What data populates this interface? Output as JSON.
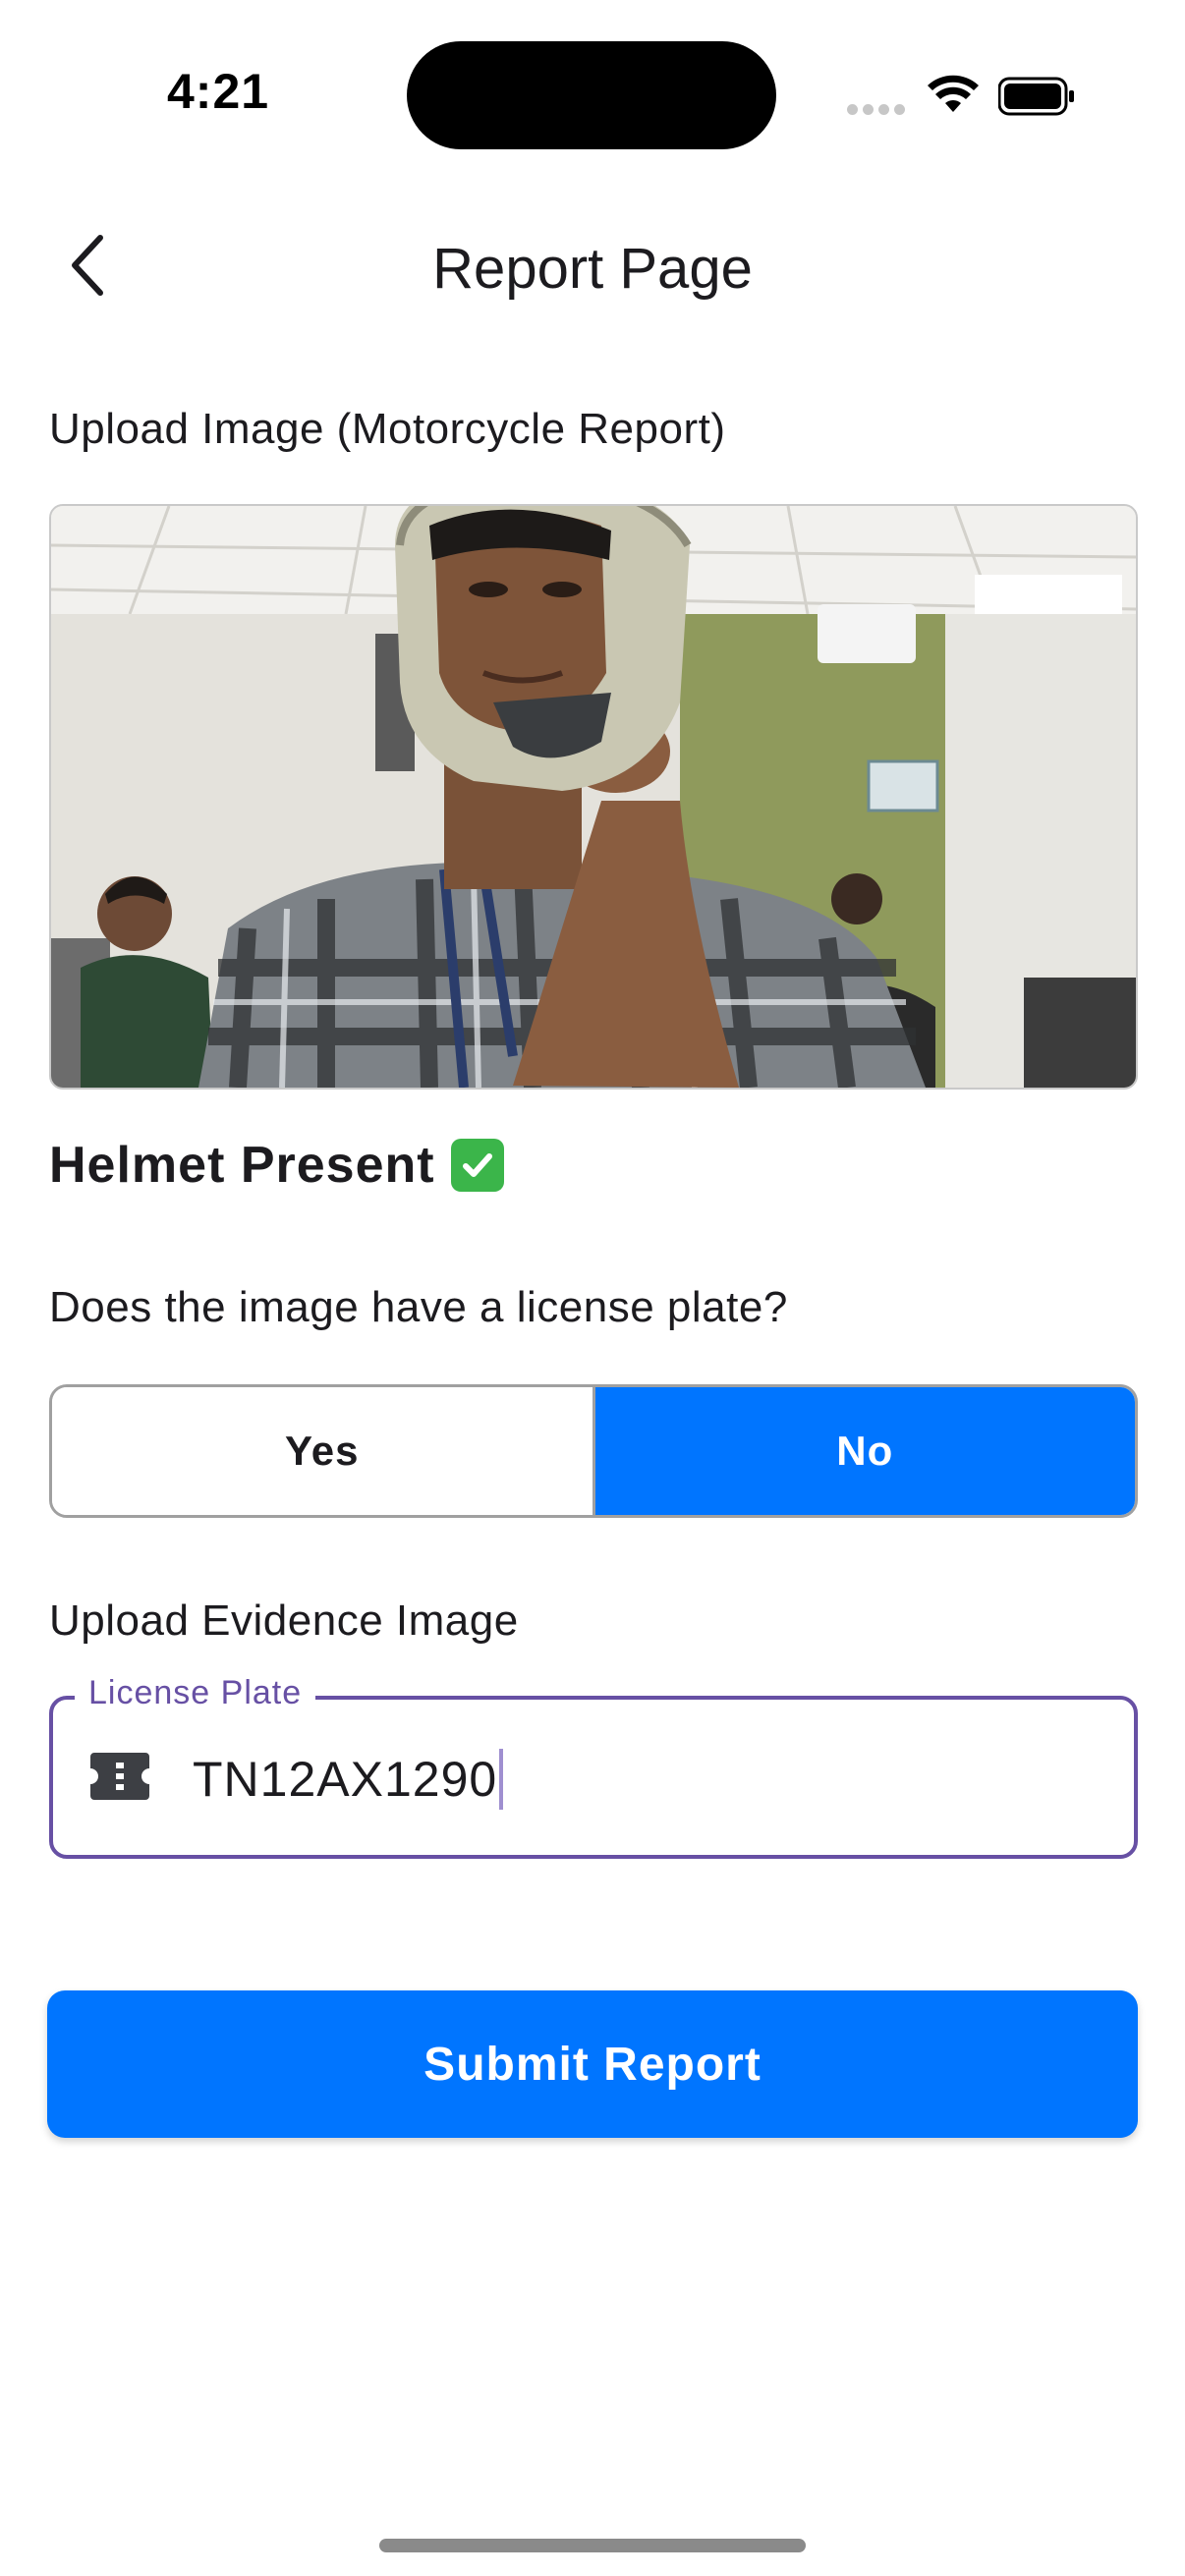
{
  "status_bar": {
    "time": "4:21"
  },
  "app_bar": {
    "title": "Report Page",
    "back_icon": "chevron-left-icon"
  },
  "upload_section": {
    "label": "Upload Image (Motorcycle Report)"
  },
  "detection": {
    "text": "Helmet Present",
    "icon": "check-mark-button-icon"
  },
  "plate_question": {
    "label": "Does the image have a license plate?",
    "options": [
      "Yes",
      "No"
    ],
    "selected": "No"
  },
  "evidence_section": {
    "label": "Upload Evidence Image"
  },
  "license_field": {
    "label": "License Plate",
    "value": "TN12AX1290",
    "icon": "ticket-icon"
  },
  "submit": {
    "label": "Submit Report"
  },
  "colors": {
    "primary": "#0075ff",
    "field_accent": "#6750a4",
    "check": "#3bb54a"
  }
}
